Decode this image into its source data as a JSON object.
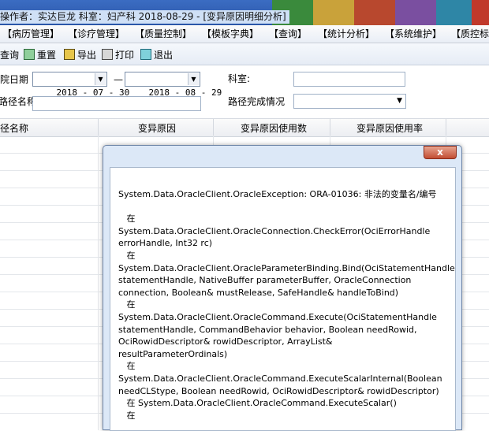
{
  "window": {
    "title": "操作者：实达巨龙  科室：妇产科  2018-08-29 - [变异原因明细分析]"
  },
  "menu": [
    {
      "label": "【病历管理】"
    },
    {
      "label": "【诊疗管理】"
    },
    {
      "label": "【质量控制】"
    },
    {
      "label": "【模板字典】"
    },
    {
      "label": "【查询】"
    },
    {
      "label": "【统计分析】"
    },
    {
      "label": "【系统维护】"
    },
    {
      "label": "【质控标"
    }
  ],
  "toolbar": {
    "query": "查询",
    "reset": "重置",
    "export": "导出",
    "print": "打印",
    "exit": "退出"
  },
  "filters": {
    "date_label": "出院日期",
    "date_from": "2018 - 07 - 30",
    "date_sep": "—",
    "date_to": "2018 - 08 - 29",
    "dept_label": "科室:",
    "path_name_label": "路径名称",
    "path_status_label": "路径完成情况"
  },
  "grid": {
    "columns": [
      "路径名称",
      "变异原因",
      "变异原因使用数",
      "变异原因使用率"
    ]
  },
  "dialog": {
    "close_label": "x",
    "message": "System.Data.OracleClient.OracleException: ORA-01036: 非法的变量名/编号\n\n   在\nSystem.Data.OracleClient.OracleConnection.CheckError(OciErrorHandle errorHandle, Int32 rc)\n   在\nSystem.Data.OracleClient.OracleParameterBinding.Bind(OciStatementHandle statementHandle, NativeBuffer parameterBuffer, OracleConnection connection, Boolean& mustRelease, SafeHandle& handleToBind)\n   在\nSystem.Data.OracleClient.OracleCommand.Execute(OciStatementHandle statementHandle, CommandBehavior behavior, Boolean needRowid, OciRowidDescriptor& rowidDescriptor, ArrayList& resultParameterOrdinals)\n   在\nSystem.Data.OracleClient.OracleCommand.ExecuteScalarInternal(Boolean needCLStype, Boolean needRowid, OciRowidDescriptor& rowidDescriptor)\n   在 System.Data.OracleClient.OracleCommand.ExecuteScalar()\n   在"
  },
  "colors": {
    "titlebar": "#2a56a8",
    "dialog_frame": "#dce8f7",
    "close_button": "#c24d33"
  }
}
